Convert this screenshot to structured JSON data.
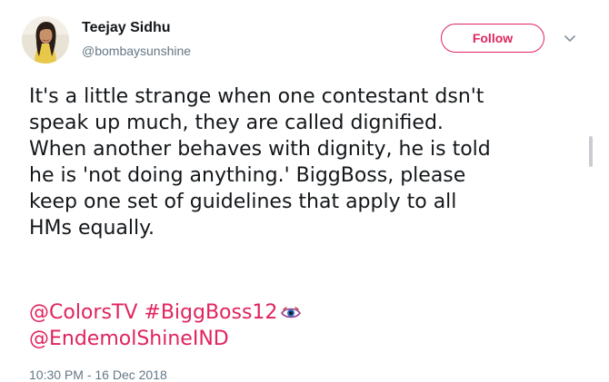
{
  "user": {
    "display_name": "Teejay Sidhu",
    "handle": "@bombaysunshine",
    "avatar_icon": "profile-photo-avatar"
  },
  "actions": {
    "follow_label": "Follow",
    "more_icon": "chevron-down-icon"
  },
  "tweet": {
    "lines": [
      "It's a little strange when one contestant dsn't",
      "speak up much, they are called dignified.",
      "When another behaves with dignity, he is told",
      "he is 'not doing anything.' BiggBoss, please",
      "keep one set of guidelines that apply to all",
      "HMs equally."
    ],
    "mention_colors": "@ColorsTV",
    "hashtag": "#BiggBoss12",
    "hashtag_emoji": "eye-emoji",
    "mention_endemol": "@EndemolShineIND",
    "timestamp": "10:30 PM - 16 Dec 2018"
  },
  "colors": {
    "accent": "#e0245e",
    "text": "#14171a",
    "secondary": "#657786"
  }
}
